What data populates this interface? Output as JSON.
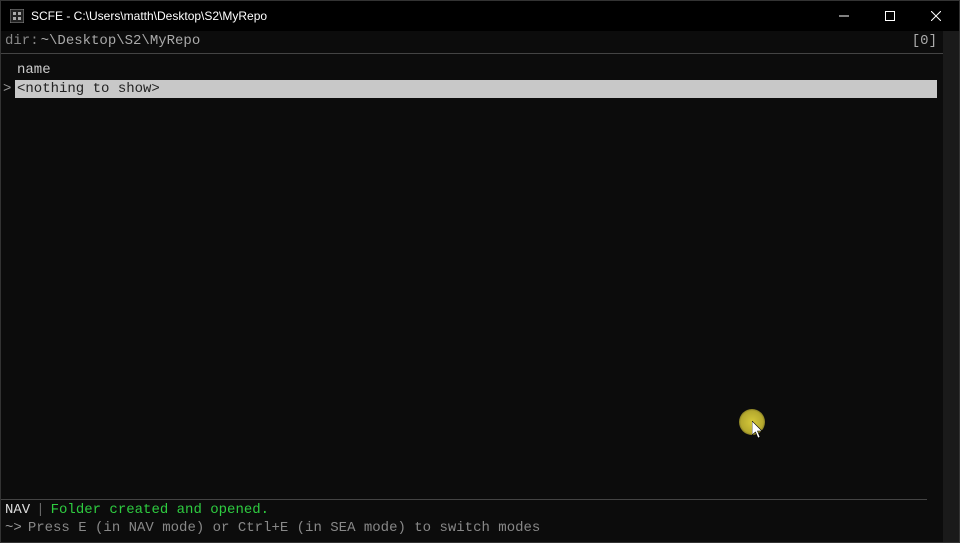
{
  "window": {
    "title": "SCFE - C:\\Users\\matth\\Desktop\\S2\\MyRepo"
  },
  "header": {
    "dir_label": "dir:",
    "dir_path": " ~\\Desktop\\S2\\MyRepo",
    "counter": "[0]"
  },
  "list": {
    "column_header": "name",
    "caret": ">",
    "placeholder": "<nothing to show>"
  },
  "status": {
    "mode": "NAV",
    "separator": "|",
    "message": "Folder created and opened.",
    "prompt_symbol": "~>",
    "hint": "Press E (in NAV mode) or Ctrl+E (in SEA mode) to switch modes"
  }
}
